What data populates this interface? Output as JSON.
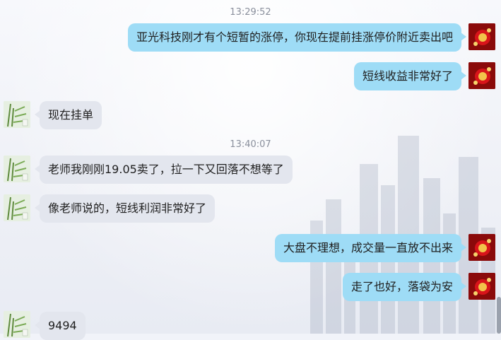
{
  "chat": {
    "timestamps": [
      "13:29:52",
      "13:40:07"
    ],
    "messages": [
      {
        "side": "right",
        "text": "亚光科技刚才有个短暂的涨停，你现在提前挂涨停价附近卖出吧"
      },
      {
        "side": "right",
        "text": "短线收益非常好了"
      },
      {
        "side": "left",
        "text": "现在挂单"
      },
      {
        "side": "left",
        "text": "老师我刚刚19.05卖了，拉一下又回落不想等了"
      },
      {
        "side": "left",
        "text": "像老师说的，短线利润非常好了"
      },
      {
        "side": "right",
        "text": "大盘不理想，成交量一直放不出来"
      },
      {
        "side": "right",
        "text": "走了也好，落袋为安"
      },
      {
        "side": "left",
        "text": "9494"
      }
    ]
  },
  "colors": {
    "bubble_right": "#9edcf6",
    "bubble_left": "#e3e6ee",
    "timestamp": "#8a8f9c"
  },
  "icons": {
    "sender_avatar": "red-lantern-avatar-icon",
    "receiver_avatar": "bamboo-painting-avatar-icon"
  }
}
